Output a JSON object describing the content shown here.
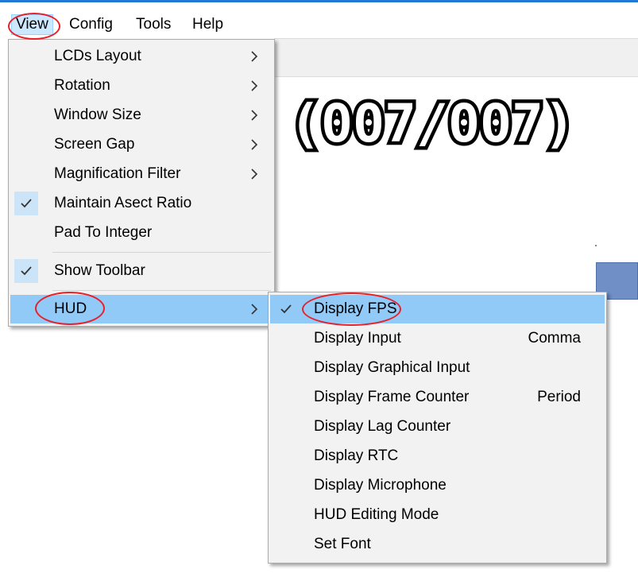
{
  "menubar": {
    "items": [
      {
        "label": "View"
      },
      {
        "label": "Config"
      },
      {
        "label": "Tools"
      },
      {
        "label": "Help"
      }
    ]
  },
  "screen": {
    "fps_text": "(007/007)"
  },
  "view_menu": {
    "items": [
      {
        "label": "LCDs Layout",
        "submenu": true
      },
      {
        "label": "Rotation",
        "submenu": true
      },
      {
        "label": "Window Size",
        "submenu": true
      },
      {
        "label": "Screen Gap",
        "submenu": true
      },
      {
        "label": "Magnification Filter",
        "submenu": true
      },
      {
        "label": "Maintain Asect Ratio",
        "checked": true
      },
      {
        "label": "Pad To Integer"
      },
      {
        "label": "Show Toolbar",
        "checked": true
      },
      {
        "label": "HUD",
        "submenu": true,
        "highlighted": true
      }
    ]
  },
  "hud_menu": {
    "items": [
      {
        "label": "Display FPS",
        "checked": true,
        "highlighted": true
      },
      {
        "label": "Display Input",
        "shortcut": "Comma"
      },
      {
        "label": "Display Graphical Input"
      },
      {
        "label": "Display Frame Counter",
        "shortcut": "Period"
      },
      {
        "label": "Display Lag Counter"
      },
      {
        "label": "Display RTC"
      },
      {
        "label": "Display Microphone"
      },
      {
        "label": "HUD Editing Mode"
      },
      {
        "label": "Set Font"
      }
    ]
  },
  "colors": {
    "highlight": "#91c9f7",
    "annotation": "#e8202a",
    "menu_bg": "#f2f2f2"
  }
}
